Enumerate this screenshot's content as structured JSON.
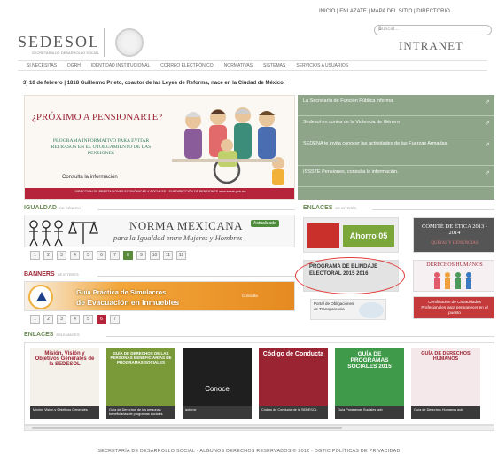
{
  "header": {
    "top_links": "INICIO | ENLAZATE | MAPA DEL SITIO | DIRECTORIO",
    "logo_text": "SEDESOL",
    "logo_sub": "SECRETARÍA DE DESARROLLO SOCIAL",
    "search_placeholder": "Buscar...",
    "intranet_label": "INTRANET"
  },
  "nav": {
    "items": [
      "SI NECESITAS",
      "DGRH",
      "IDENTIDAD INSTITUCIONAL",
      "CORREO ELECTRÓNICO",
      "NORMATIVAS",
      "SISTEMAS",
      "SERVICIOS A USUARIOS"
    ]
  },
  "efemeride": "3) 10 de febrero | 1818 Guillermo Prieto, coautor de las Leyes de Reforma, nace en la Ciudad de México.",
  "hero": {
    "title": "¿PRÓXIMO A PENSIONARTE?",
    "subtitle": "PROGRAMA INFORMATIVO PARA EVITAR RETRASOS EN EL OTORGAMIENTO DE LAS PENSIONES",
    "link": "Consulta la información",
    "footer": "DIRECCIÓN DE PRESTACIONES ECONÓMICAS Y SOCIALES - SUBDIRECCIÓN DE PENSIONES www.issste.gob.mx"
  },
  "side_news": [
    "La Secretaría de Función Pública informa",
    "Sedesol en contra de la Violencia de Género",
    "SEDENA te invita conocer las actividades de las Fuerzas Armadas.",
    "ISSSTE Pensiones, consulta la información."
  ],
  "igualdad": {
    "heading": "IGUALDAD",
    "heading_small": "DE GÉNERO",
    "title": "NORMA MEXICANA",
    "subtitle": "para la Igualdad entre Mujeres y Hombres",
    "badge": "Actualizada",
    "pages": [
      "1",
      "2",
      "3",
      "4",
      "5",
      "6",
      "7",
      "8",
      "9",
      "10",
      "11",
      "12"
    ],
    "active_page": "8"
  },
  "banners": {
    "heading": "BANNERS",
    "heading_small": "DE INTERÉS",
    "line1": "Guía Práctica de Simulacros",
    "line2": "de Evacuación en Inmuebles",
    "consulta": "Consulta",
    "pages": [
      "1",
      "2",
      "3",
      "4",
      "5",
      "6",
      "7"
    ],
    "active_page": "6"
  },
  "enlaces_interes": {
    "heading": "ENLACES",
    "heading_small": "DE INTERÉS",
    "tiles": [
      {
        "label": "Ahorro 05"
      },
      {
        "label": "COMITÉ DE ÉTICA 2013 - 2014",
        "sub": "QUEJAS Y DENUNCIAS"
      },
      {
        "label": "PROGRAMA DE BLINDAJE ELECTORAL 2015 2016"
      },
      {
        "label": "DERECHOS HUMANOS"
      },
      {
        "label": "Portal de Obligaciones de Transparencia"
      },
      {
        "label": "Certificación de Capacidades Profesionales para permanecer en el puesto"
      }
    ]
  },
  "enlaces_relevantes": {
    "heading": "ENLACES",
    "heading_small": "RELEVANTES",
    "cards": [
      {
        "title": "Misión, Visión y Objetivos Generales de la SEDESOL",
        "caption": "Misión, Visión y Objetivos Generales"
      },
      {
        "title": "GUÍA DE DERECHOS DE LAS PERSONAS BENEFICIARIAS DE PROGRAMAS SOCIALES",
        "caption": "Guía de Derechos de las personas beneficiarias de programas sociales"
      },
      {
        "title": "Conoce",
        "caption": "gob.mx"
      },
      {
        "title": "Código de Conducta",
        "caption": "Código de Conducta de la SEDESOL"
      },
      {
        "title": "GUÍA DE PROGRAMAS SOCIALES 2015",
        "caption": "Guía Programas Sociales gob"
      },
      {
        "title": "GUÍA DE DERECHOS HUMANOS",
        "caption": "Guía de Derechos Humanos gob"
      }
    ]
  },
  "footer": "SECRETARÍA DE DESARROLLO SOCIAL - ALGUNOS DERECHOS RESERVADOS © 2012 - DGTIC POLÍTICAS DE PRIVACIDAD",
  "colors": {
    "accent_red": "#9b2433",
    "accent_green": "#6d8c55",
    "panel_green": "#8ea58a"
  }
}
